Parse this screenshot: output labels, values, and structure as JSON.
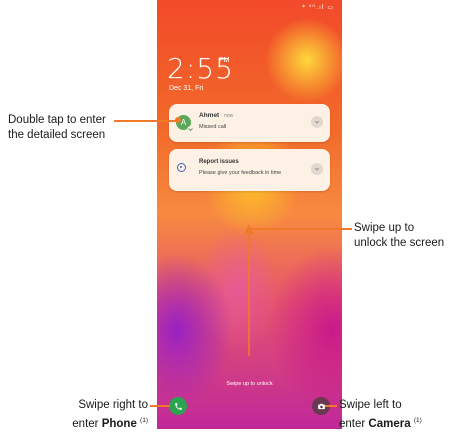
{
  "status_bar": {
    "icons_text": "* ⁴ᴳ.ıl ▭"
  },
  "lock_screen": {
    "time": "2:55",
    "ampm": "PM",
    "date": "Dec 31, Fri",
    "swipe_hint": "Swipe up to unlock"
  },
  "notifications": [
    {
      "avatar_letter": "A",
      "title": "Ahmet",
      "meta": "· now",
      "body": "Missed call",
      "icon": "avatar-icon"
    },
    {
      "title": "Report issues",
      "body": "Please give your feedback in time",
      "icon": "info-icon"
    }
  ],
  "callouts": {
    "notification": {
      "line1": "Double tap to enter",
      "line2": "the detailed screen"
    },
    "unlock": {
      "line1": "Swipe up to",
      "line2": "unlock the screen"
    },
    "phone": {
      "line1": "Swipe right to",
      "line2_prefix": "enter ",
      "line2_bold": "Phone",
      "note": "(1)"
    },
    "camera": {
      "line1": "Swipe left to",
      "line2_prefix": "enter ",
      "line2_bold": "Camera",
      "note": "(1)"
    }
  },
  "colors": {
    "accent": "#f07a2a",
    "phone_button": "#2aa44f",
    "camera_button": "#6a3850"
  }
}
